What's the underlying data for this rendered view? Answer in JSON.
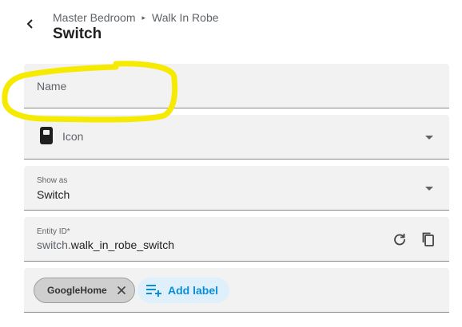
{
  "header": {
    "back_icon": "chevron-left-icon",
    "breadcrumb": [
      "Master Bedroom",
      "Walk In Robe"
    ],
    "breadcrumb_separator": "▸",
    "title": "Switch"
  },
  "form": {
    "name": {
      "placeholder": "Name",
      "value": ""
    },
    "icon": {
      "label": "Icon",
      "icon": "switch-device-icon"
    },
    "show_as": {
      "label": "Show as",
      "value": "Switch"
    },
    "entity_id": {
      "label": "Entity ID*",
      "prefix": "switch.",
      "suffix": "walk_in_robe_switch",
      "reset_icon": "restore-icon",
      "copy_icon": "copy-icon"
    },
    "labels": {
      "chips": [
        "GoogleHome"
      ],
      "add_label": "Add label"
    }
  },
  "annotation": {
    "color": "#f5ea00"
  },
  "colors": {
    "accent": "#0a8ed6",
    "field_bg": "#f2f2f2"
  }
}
